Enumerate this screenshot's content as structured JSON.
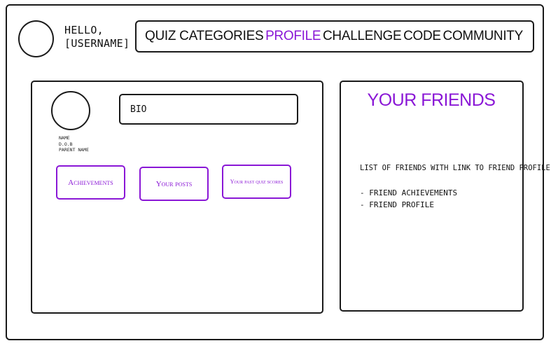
{
  "header": {
    "greeting_line1": "HELLO,",
    "greeting_line2": "[USERNAME]"
  },
  "nav": {
    "items": [
      {
        "label": "QUIZ CATEGORIES",
        "active": false
      },
      {
        "label": "PROFILE",
        "active": true
      },
      {
        "label": "CHALLENGE",
        "active": false
      },
      {
        "label": "CODE",
        "active": false
      },
      {
        "label": "COMMUNITY",
        "active": false
      }
    ]
  },
  "profile": {
    "bio_label": "BIO",
    "details": [
      "NAME",
      "D.O.B",
      "PARENT NAME"
    ],
    "buttons": {
      "achievements": "Achievements",
      "posts": "Your posts",
      "quiz_scores": "Your past quiz scores"
    }
  },
  "friends": {
    "title": "YOUR FRIENDS",
    "description": "LIST OF FRIENDS WITH LINK TO FRIEND PROFILE",
    "list": [
      "- Friend achievements",
      "- Friend profile"
    ]
  },
  "colors": {
    "accent": "#8a17d6",
    "border": "#1a1a1a"
  }
}
